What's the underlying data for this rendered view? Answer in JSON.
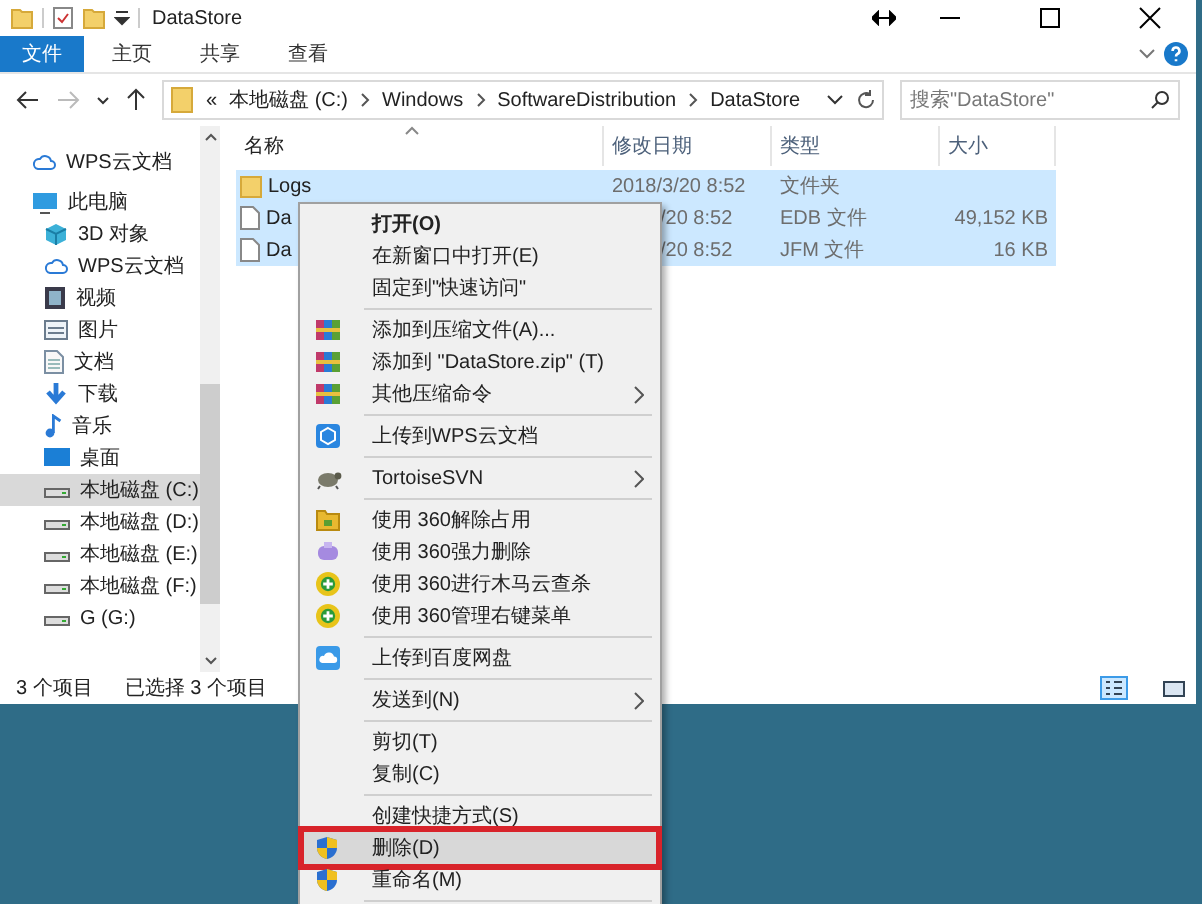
{
  "window": {
    "title": "DataStore"
  },
  "ribbon_tabs": [
    {
      "label": "文件",
      "selected": true
    },
    {
      "label": "主页",
      "selected": false
    },
    {
      "label": "共享",
      "selected": false
    },
    {
      "label": "查看",
      "selected": false
    }
  ],
  "address": {
    "overflow": "«",
    "path": [
      "本地磁盘 (C:)",
      "Windows",
      "SoftwareDistribution",
      "DataStore"
    ]
  },
  "search": {
    "placeholder": "搜索\"DataStore\""
  },
  "sidebar": {
    "items": [
      {
        "label": "WPS云文档",
        "kind": "cloud",
        "selected": false
      },
      {
        "label": "此电脑",
        "kind": "pc",
        "selected": false,
        "children": [
          {
            "label": "3D 对象",
            "kind": "cube",
            "selected": false
          },
          {
            "label": "WPS云文档",
            "kind": "cloud",
            "selected": false
          },
          {
            "label": "视频",
            "kind": "video",
            "selected": false
          },
          {
            "label": "图片",
            "kind": "picture",
            "selected": false
          },
          {
            "label": "文档",
            "kind": "document",
            "selected": false
          },
          {
            "label": "下载",
            "kind": "download",
            "selected": false
          },
          {
            "label": "音乐",
            "kind": "music",
            "selected": false
          },
          {
            "label": "桌面",
            "kind": "desktop",
            "selected": false
          },
          {
            "label": "本地磁盘 (C:)",
            "kind": "drive",
            "selected": true
          },
          {
            "label": "本地磁盘 (D:)",
            "kind": "drive",
            "selected": false
          },
          {
            "label": "本地磁盘 (E:)",
            "kind": "drive",
            "selected": false
          },
          {
            "label": "本地磁盘 (F:)",
            "kind": "drive",
            "selected": false
          },
          {
            "label": "G (G:)",
            "kind": "drive",
            "selected": false
          }
        ]
      }
    ]
  },
  "table": {
    "columns": [
      "名称",
      "修改日期",
      "类型",
      "大小"
    ],
    "rows": [
      {
        "name": "Logs",
        "kind": "folder",
        "modified": "2018/3/20 8:52",
        "type": "文件夹",
        "size": "",
        "selected": true
      },
      {
        "name": "Da",
        "kind": "file",
        "modified": "/20 8:52",
        "type": "EDB 文件",
        "size": "49,152 KB",
        "selected": true
      },
      {
        "name": "Da",
        "kind": "file",
        "modified": "/20 8:52",
        "type": "JFM 文件",
        "size": "16 KB",
        "selected": true
      }
    ]
  },
  "status_bar": {
    "count": "3 个项目",
    "selection": "已选择 3 个项目"
  },
  "context_menu": {
    "items": [
      {
        "kind": "plain",
        "label": "打开(O)",
        "default": true,
        "submenu": false,
        "highlighted": false,
        "outlined": false
      },
      {
        "kind": "plain",
        "label": "在新窗口中打开(E)",
        "default": false,
        "submenu": false,
        "highlighted": false,
        "outlined": false
      },
      {
        "kind": "plain",
        "label": "固定到\"快速访问\"",
        "default": false,
        "submenu": false,
        "highlighted": false,
        "outlined": false
      },
      {
        "kind": "separator"
      },
      {
        "kind": "archive",
        "label": "添加到压缩文件(A)...",
        "default": false,
        "submenu": false,
        "highlighted": false,
        "outlined": false
      },
      {
        "kind": "archive",
        "label": "添加到 \"DataStore.zip\" (T)",
        "default": false,
        "submenu": false,
        "highlighted": false,
        "outlined": false
      },
      {
        "kind": "archive",
        "label": "其他压缩命令",
        "default": false,
        "submenu": true,
        "highlighted": false,
        "outlined": false
      },
      {
        "kind": "separator"
      },
      {
        "kind": "cloud_upload",
        "label": "上传到WPS云文档",
        "default": false,
        "submenu": false,
        "highlighted": false,
        "outlined": false
      },
      {
        "kind": "separator"
      },
      {
        "kind": "svn",
        "label": "TortoiseSVN",
        "default": false,
        "submenu": true,
        "highlighted": false,
        "outlined": false
      },
      {
        "kind": "separator"
      },
      {
        "kind": "unlock",
        "label": "使用 360解除占用",
        "default": false,
        "submenu": false,
        "highlighted": false,
        "outlined": false
      },
      {
        "kind": "shred",
        "label": "使用 360强力删除",
        "default": false,
        "submenu": false,
        "highlighted": false,
        "outlined": false
      },
      {
        "kind": "scan",
        "label": "使用 360进行木马云查杀",
        "default": false,
        "submenu": false,
        "highlighted": false,
        "outlined": false
      },
      {
        "kind": "scan",
        "label": "使用 360管理右键菜单",
        "default": false,
        "submenu": false,
        "highlighted": false,
        "outlined": false
      },
      {
        "kind": "separator"
      },
      {
        "kind": "netdisk",
        "label": "上传到百度网盘",
        "default": false,
        "submenu": false,
        "highlighted": false,
        "outlined": false
      },
      {
        "kind": "separator"
      },
      {
        "kind": "plain",
        "label": "发送到(N)",
        "default": false,
        "submenu": true,
        "highlighted": false,
        "outlined": false
      },
      {
        "kind": "separator"
      },
      {
        "kind": "plain",
        "label": "剪切(T)",
        "default": false,
        "submenu": false,
        "highlighted": false,
        "outlined": false
      },
      {
        "kind": "plain",
        "label": "复制(C)",
        "default": false,
        "submenu": false,
        "highlighted": false,
        "outlined": false
      },
      {
        "kind": "separator"
      },
      {
        "kind": "plain",
        "label": "创建快捷方式(S)",
        "default": false,
        "submenu": false,
        "highlighted": false,
        "outlined": false
      },
      {
        "kind": "admin",
        "label": "删除(D)",
        "default": false,
        "submenu": false,
        "highlighted": true,
        "outlined": true
      },
      {
        "kind": "admin",
        "label": "重命名(M)",
        "default": false,
        "submenu": false,
        "highlighted": false,
        "outlined": false
      },
      {
        "kind": "separator"
      }
    ]
  }
}
